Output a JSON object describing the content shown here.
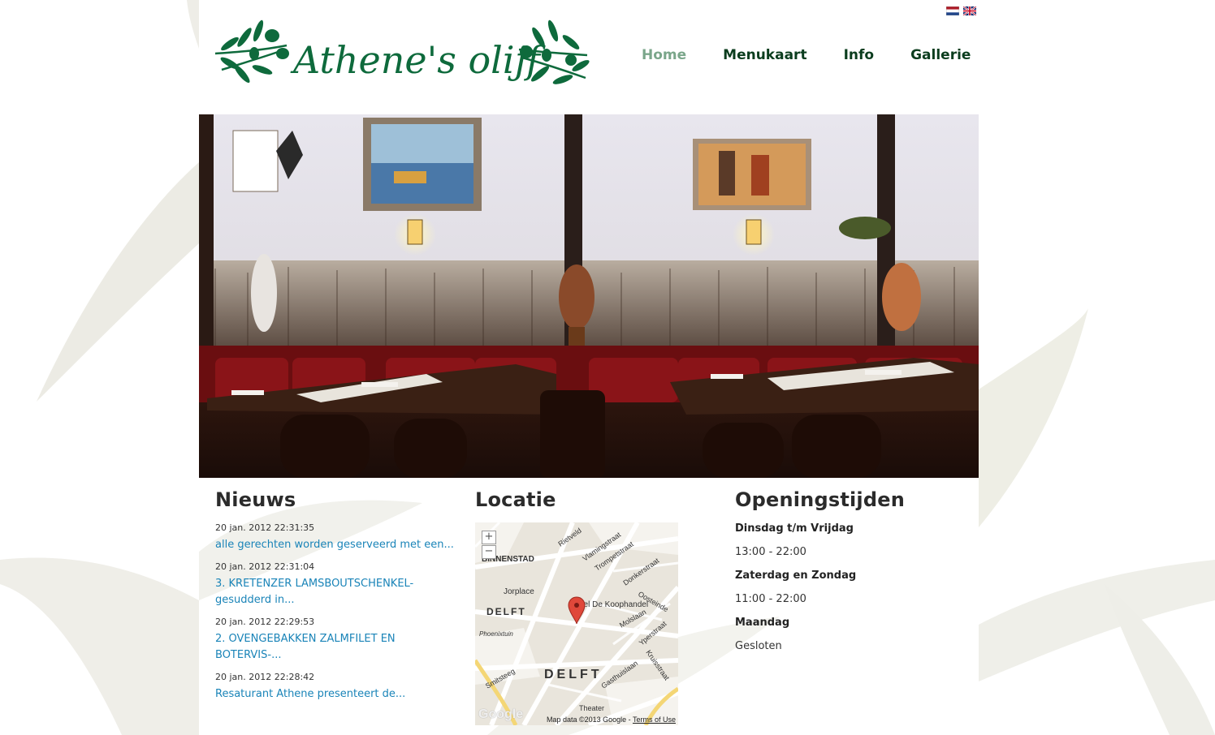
{
  "languages": [
    {
      "name": "Nederlands",
      "icon": "flag-nl-icon"
    },
    {
      "name": "English",
      "icon": "flag-en-icon"
    }
  ],
  "brand": {
    "logo_text": "Athene's olijf",
    "logo_color": "#0e6a3c"
  },
  "nav": {
    "items": [
      {
        "label": "Home",
        "active": true
      },
      {
        "label": "Menukaart",
        "active": false
      },
      {
        "label": "Info",
        "active": false
      },
      {
        "label": "Gallerie",
        "active": false
      }
    ]
  },
  "hero": {
    "alt": "Restaurant interior"
  },
  "news": {
    "title": "Nieuws",
    "items": [
      {
        "date": "20 jan. 2012 22:31:35",
        "text": "alle gerechten worden geserveerd met een..."
      },
      {
        "date": "20 jan. 2012 22:31:04",
        "text": "3. KRETENZER LAMSBOUTSCHENKEL-gesudderd in..."
      },
      {
        "date": "20 jan. 2012 22:29:53",
        "text": "2. OVENGEBAKKEN ZALMFILET EN BOTERVIS-..."
      },
      {
        "date": "20 jan. 2012 22:28:42",
        "text": "Resaturant Athene presenteert de..."
      }
    ]
  },
  "location": {
    "title": "Locatie",
    "zoom_in": "+",
    "zoom_out": "−",
    "map_labels": {
      "binnenstad": "BINNENSTAD",
      "delft_small": "DELFT",
      "delft_big": "DELFT",
      "jorplace": "Jorplace",
      "hotel": "Hotel De Koophandel",
      "phoenixtuin": "Phoenixtuin",
      "rietveld": "Rietveld",
      "vlamingstraat": "Vlamingstraat",
      "trompetstraat": "Trompetstraat",
      "donkerstraat": "Donkerstraat",
      "oosteinde": "Oosteinde",
      "molslaan": "Molslaan",
      "yperstraat": "Yperstraat",
      "kruisstraat": "Kruisstraat",
      "gasthuislaan": "Gasthuislaan",
      "smitsteeg": "Smitsteeg",
      "theater": "Theater"
    },
    "attribution": "Map data ©2013 Google -",
    "terms": "Terms of Use",
    "google": "Google"
  },
  "hours": {
    "title": "Openingstijden",
    "rows": [
      {
        "day": "Dinsdag t/m Vrijdag",
        "time": "13:00 - 22:00"
      },
      {
        "day": "Zaterdag en Zondag",
        "time": "11:00 - 22:00"
      },
      {
        "day": "Maandag",
        "time": "Gesloten"
      }
    ]
  },
  "colors": {
    "nav_text": "#0b3d1e",
    "nav_active": "#7aa68a",
    "link": "#1a84b8",
    "heading": "#2b2b2b"
  }
}
